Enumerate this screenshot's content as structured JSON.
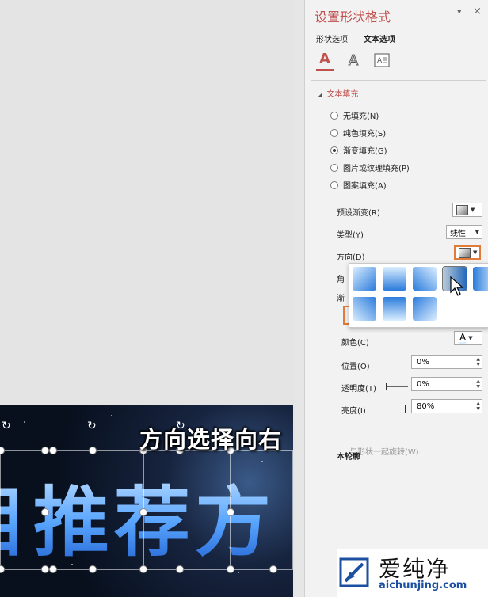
{
  "pane": {
    "title": "设置形状格式",
    "pin": "▾",
    "close": "×",
    "tabs": [
      "形状选项",
      "文本选项"
    ],
    "icons": [
      "text-fill-icon",
      "text-outline-icon",
      "textbox-icon"
    ],
    "icon_glyphs": [
      "A",
      "A"
    ],
    "section_title": "文本填充",
    "fill_options": [
      {
        "label": "无填充(N)",
        "selected": false
      },
      {
        "label": "纯色填充(S)",
        "selected": false
      },
      {
        "label": "渐变填充(G)",
        "selected": true
      },
      {
        "label": "图片或纹理填充(P)",
        "selected": false
      },
      {
        "label": "图案填充(A)",
        "selected": false
      }
    ],
    "preset_label": "预设渐变(R)",
    "type_label": "类型(Y)",
    "type_value": "线性",
    "direction_label": "方向(D)",
    "angle_label_partial": "角",
    "stops_label_partial": "渐",
    "color_label": "颜色(C)",
    "color_glyph": "A",
    "position_label": "位置(O)",
    "position_value": "0%",
    "transparency_label": "透明度(T)",
    "transparency_value": "0%",
    "brightness_label": "亮度(I)",
    "brightness_value": "80%",
    "rotate_with_shape": "与形状一起旋转(W)",
    "outline_section_partial": "本轮廓"
  },
  "slide": {
    "text": "目推荐方"
  },
  "subtitle": "方向选择向右",
  "watermark": {
    "chinese": "爱纯净",
    "url": "aichunjing.com"
  },
  "colors": {
    "accent": "#c0504d",
    "gradient_blue": "#2a7bdc",
    "gradient_light": "#dbeeff"
  }
}
